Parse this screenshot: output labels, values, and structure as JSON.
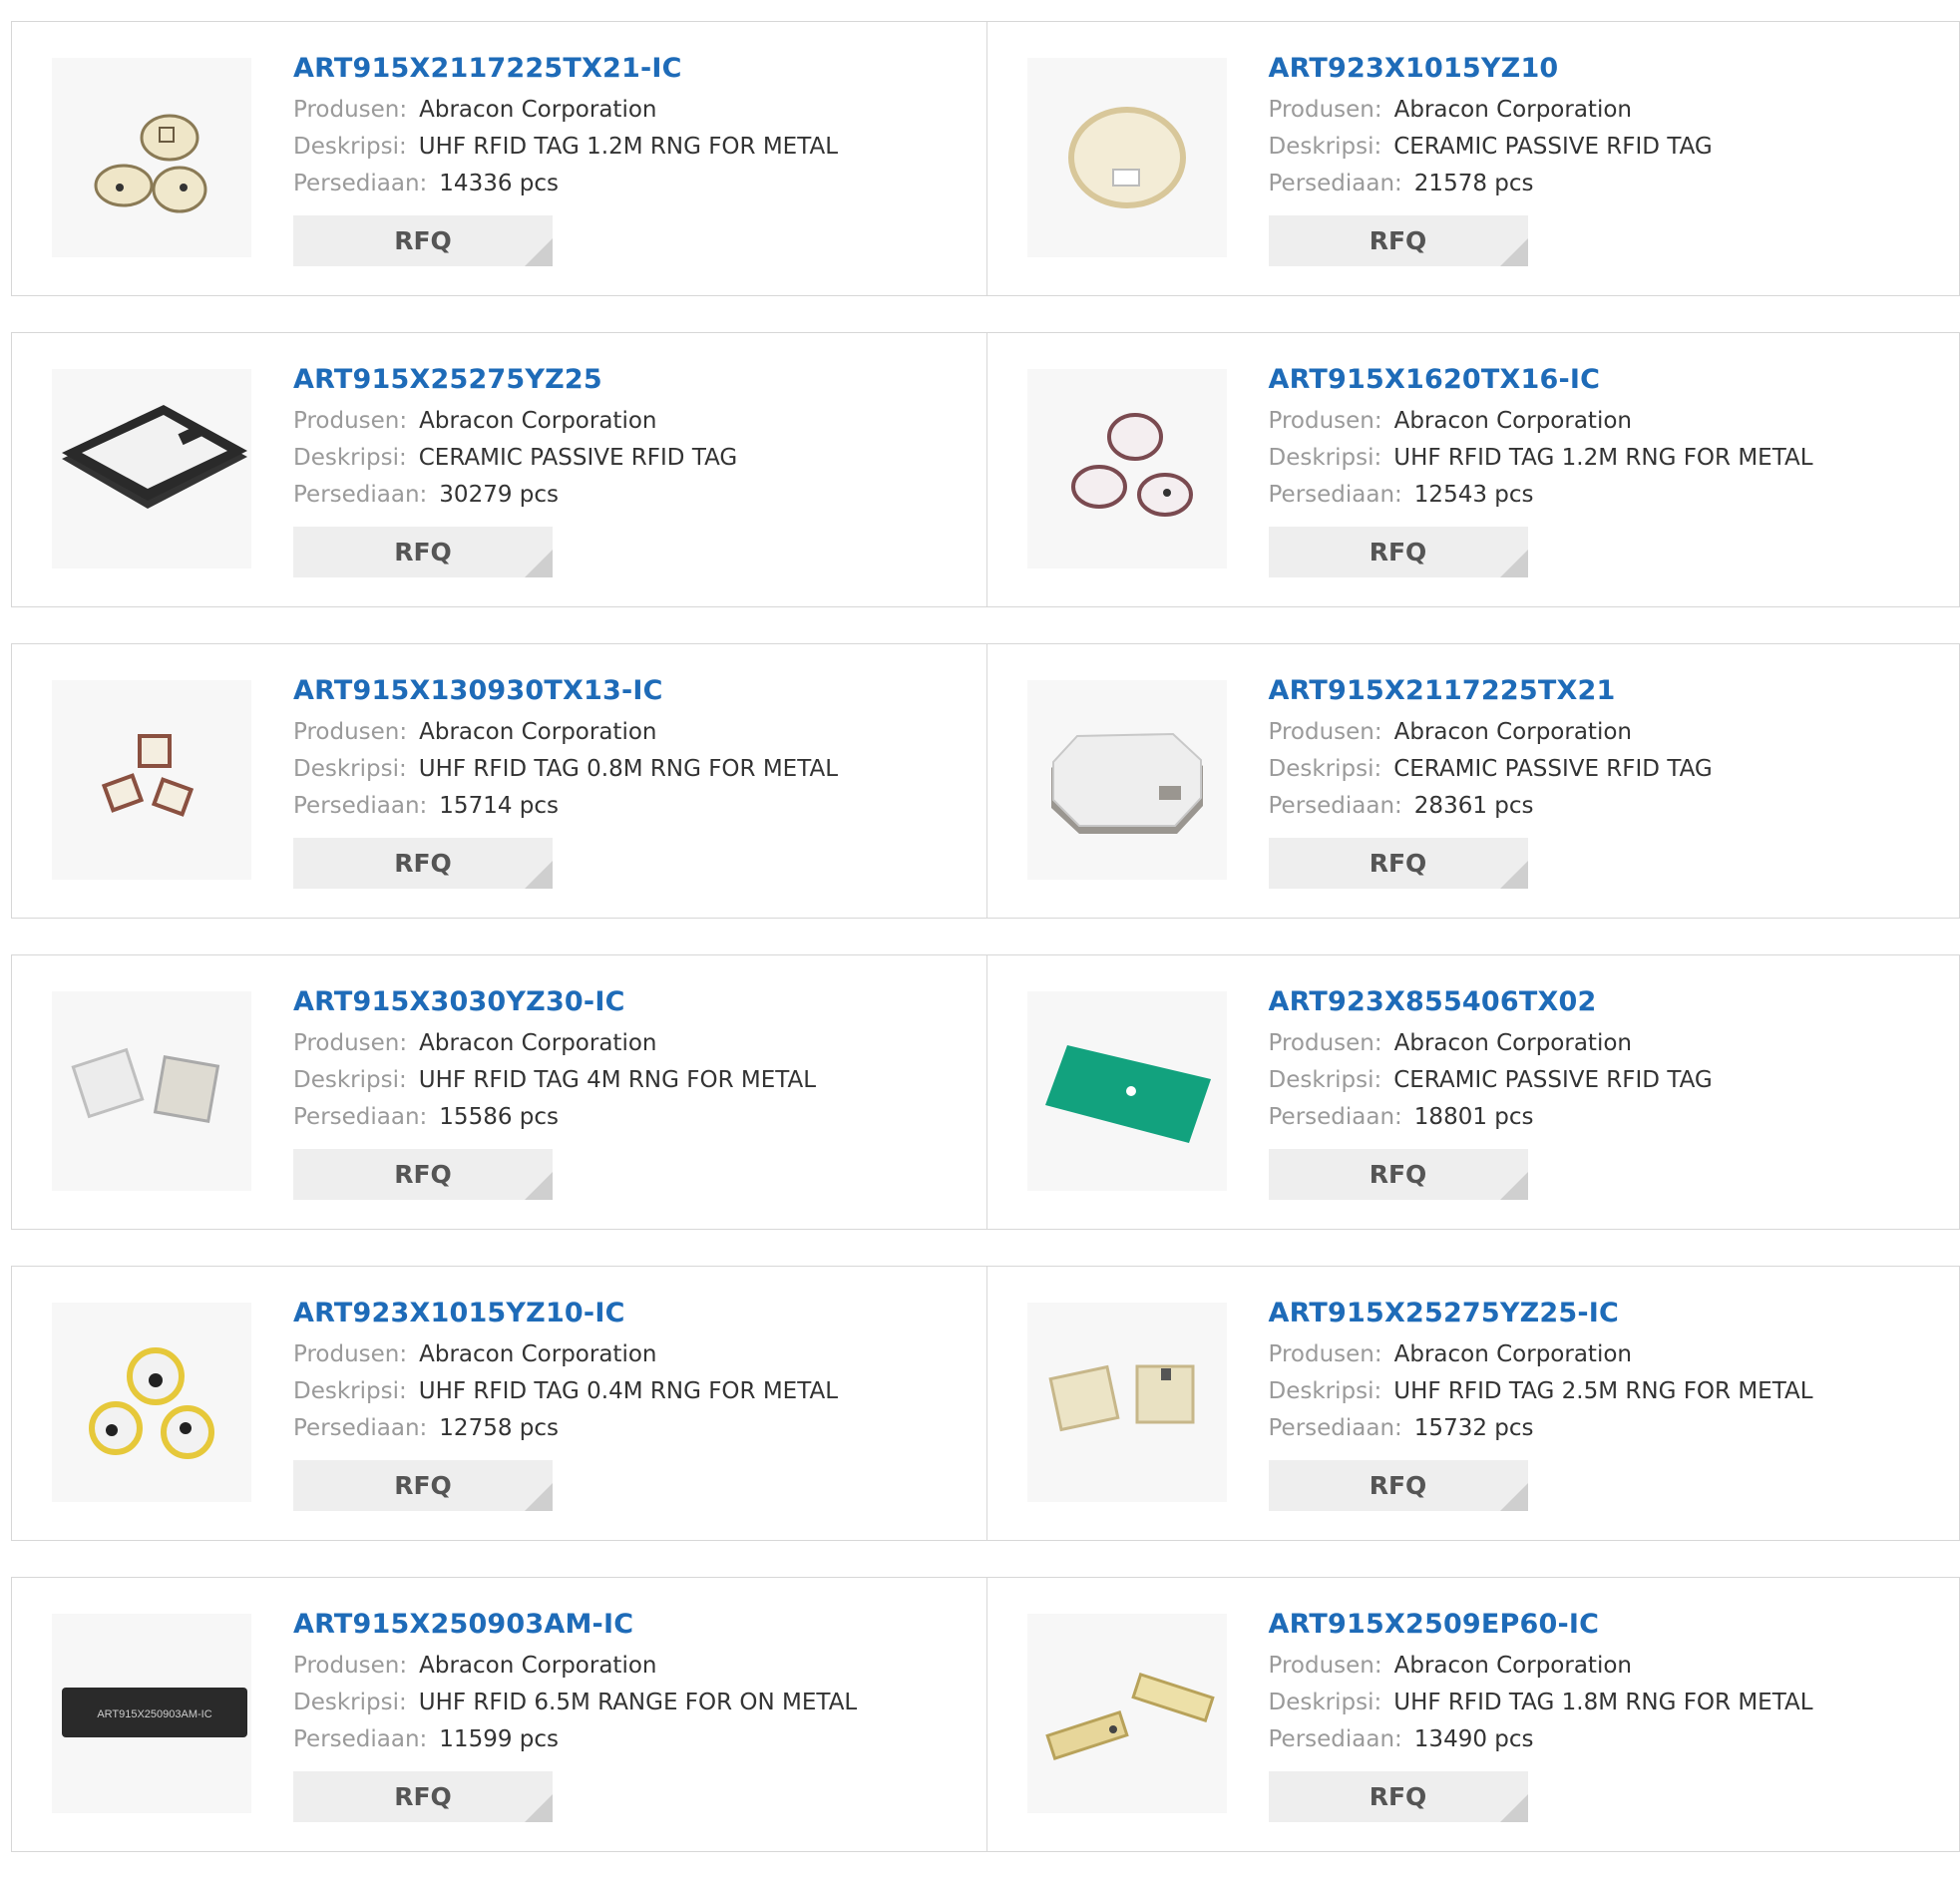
{
  "labels": {
    "manufacturer": "Produsen:",
    "description": "Deskripsi:",
    "stock": "Persediaan:",
    "rfq": "RFQ"
  },
  "products": [
    {
      "part": "ART915X2117225TX21-IC",
      "manufacturer": "Abracon Corporation",
      "description": "UHF RFID TAG 1.2M RNG FOR METAL",
      "stock": "14336 pcs",
      "image_icon": "three-ceramic-ovals"
    },
    {
      "part": "ART923X1015YZ10",
      "manufacturer": "Abracon Corporation",
      "description": "CERAMIC PASSIVE RFID TAG",
      "stock": "21578 pcs",
      "image_icon": "ceramic-disc"
    },
    {
      "part": "ART915X25275YZ25",
      "manufacturer": "Abracon Corporation",
      "description": "CERAMIC PASSIVE RFID TAG",
      "stock": "30279 pcs",
      "image_icon": "square-tag-dark"
    },
    {
      "part": "ART915X1620TX16-IC",
      "manufacturer": "Abracon Corporation",
      "description": "UHF RFID TAG 1.2M RNG FOR METAL",
      "stock": "12543 pcs",
      "image_icon": "three-round-tags"
    },
    {
      "part": "ART915X130930TX13-IC",
      "manufacturer": "Abracon Corporation",
      "description": "UHF RFID TAG 0.8M RNG FOR METAL",
      "stock": "15714 pcs",
      "image_icon": "three-small-tags"
    },
    {
      "part": "ART915X2117225TX21",
      "manufacturer": "Abracon Corporation",
      "description": "CERAMIC PASSIVE RFID TAG",
      "stock": "28361 pcs",
      "image_icon": "octagon-tag"
    },
    {
      "part": "ART915X3030YZ30-IC",
      "manufacturer": "Abracon Corporation",
      "description": "UHF RFID TAG 4M RNG FOR METAL",
      "stock": "15586 pcs",
      "image_icon": "two-square-tags"
    },
    {
      "part": "ART923X855406TX02",
      "manufacturer": "Abracon Corporation",
      "description": "CERAMIC PASSIVE RFID TAG",
      "stock": "18801 pcs",
      "image_icon": "green-board"
    },
    {
      "part": "ART923X1015YZ10-IC",
      "manufacturer": "Abracon Corporation",
      "description": "UHF RFID TAG 0.4M RNG FOR METAL",
      "stock": "12758 pcs",
      "image_icon": "three-yellow-discs"
    },
    {
      "part": "ART915X25275YZ25-IC",
      "manufacturer": "Abracon Corporation",
      "description": "UHF RFID TAG 2.5M RNG FOR METAL",
      "stock": "15732 pcs",
      "image_icon": "two-beige-tags"
    },
    {
      "part": "ART915X250903AM-IC",
      "manufacturer": "Abracon Corporation",
      "description": "UHF RFID 6.5M RANGE FOR ON METAL",
      "stock": "11599 pcs",
      "image_icon": "black-bar-tag",
      "image_text": "ART915X250903AM-IC"
    },
    {
      "part": "ART915X2509EP60-IC",
      "manufacturer": "Abracon Corporation",
      "description": "UHF RFID TAG 1.8M RNG FOR METAL",
      "stock": "13490 pcs",
      "image_icon": "two-bar-tags"
    }
  ]
}
